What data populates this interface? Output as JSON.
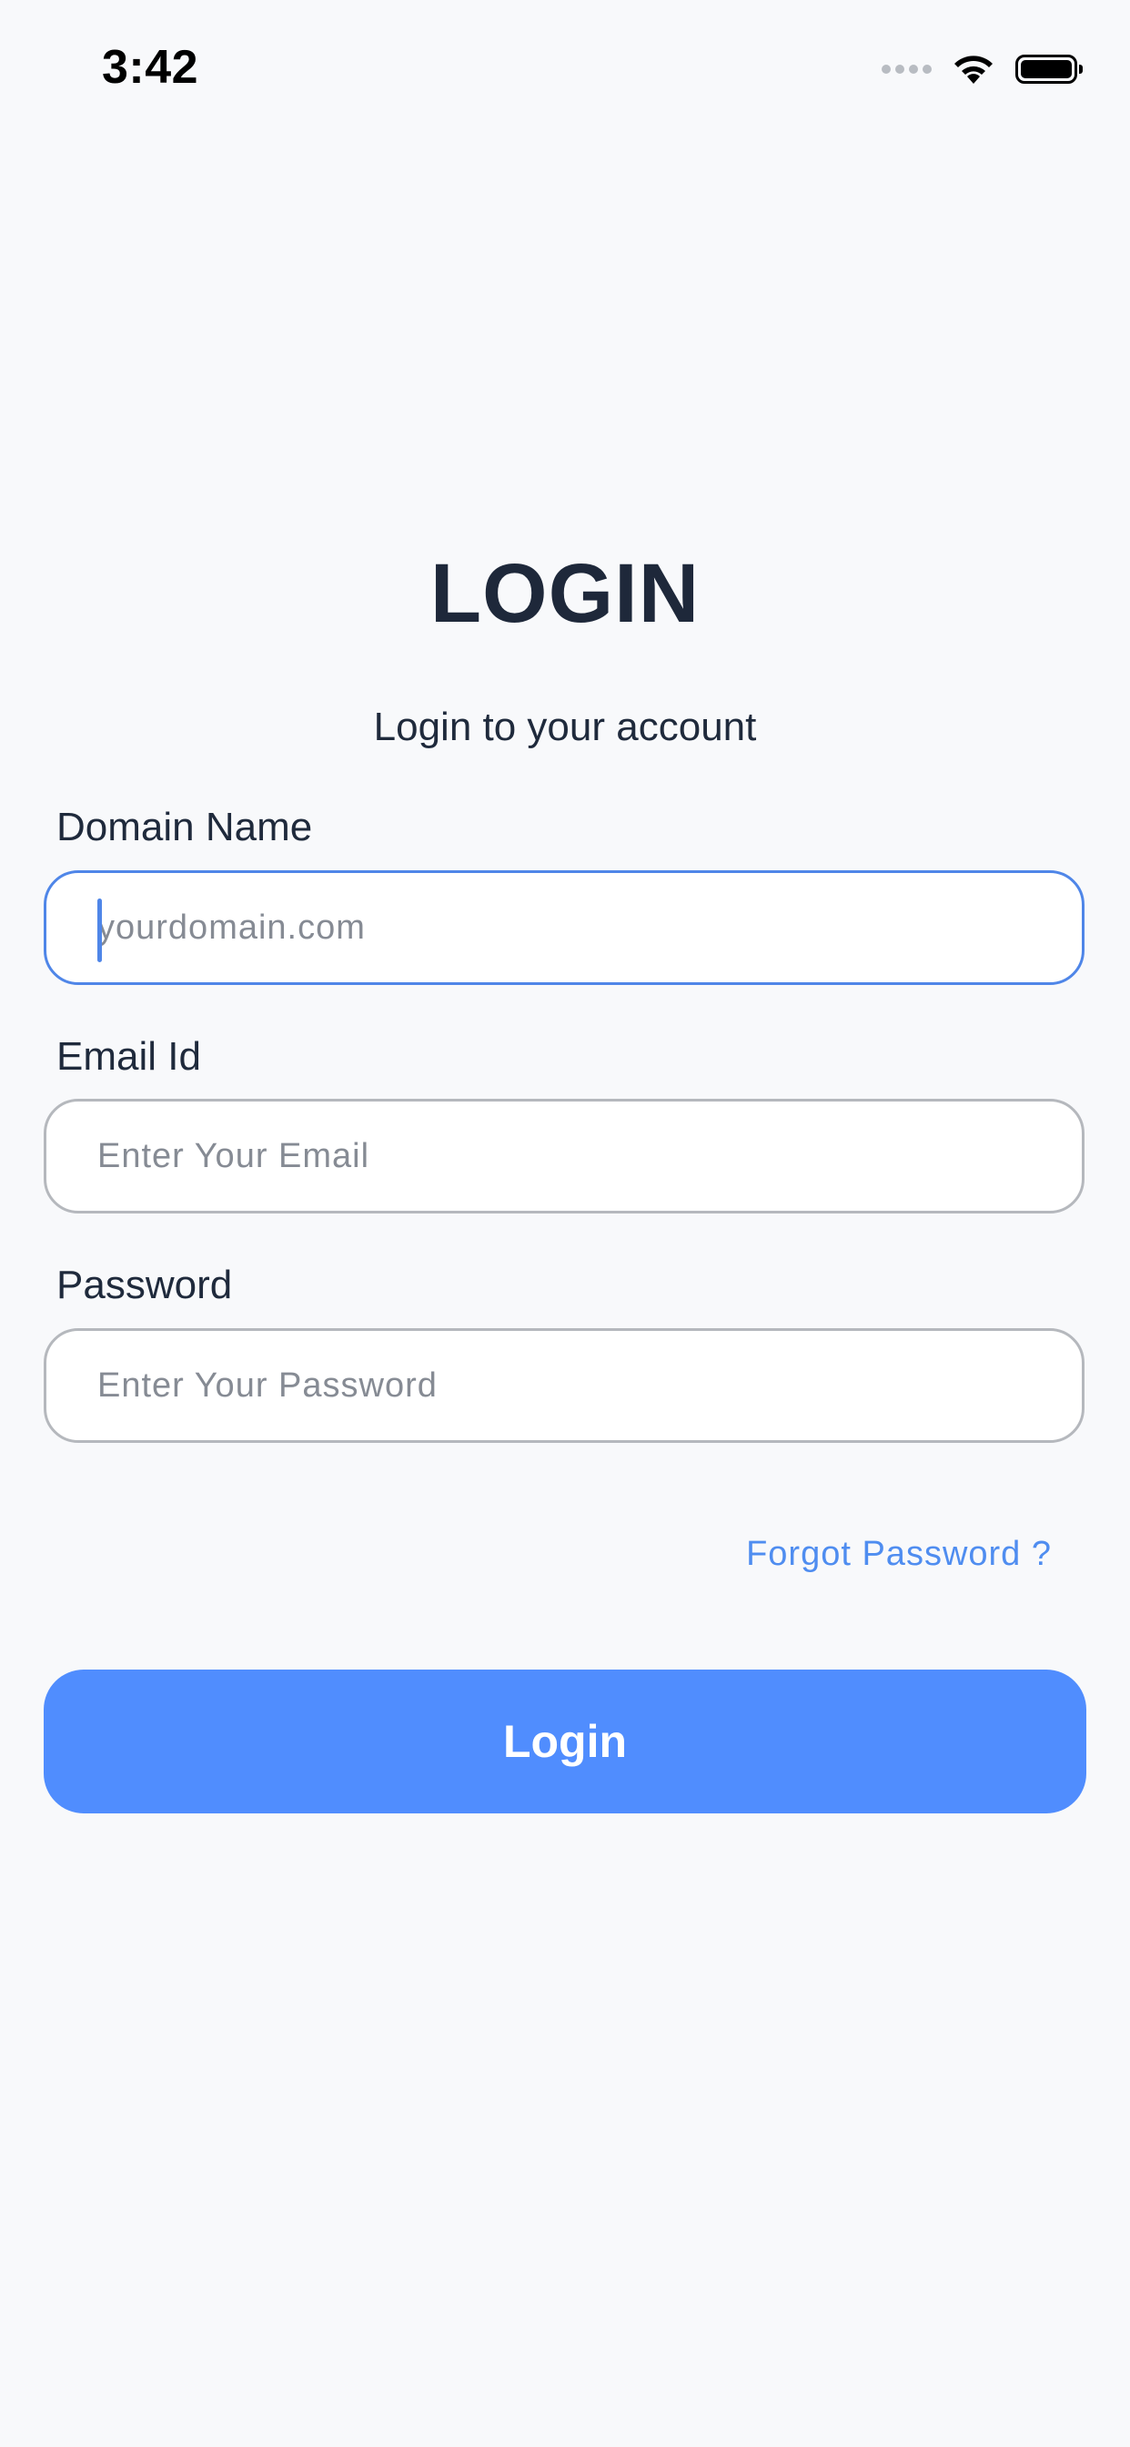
{
  "status_bar": {
    "time": "3:42"
  },
  "header": {
    "title": "LOGIN",
    "subtitle": "Login to your account"
  },
  "form": {
    "domain": {
      "label": "Domain Name",
      "placeholder": "yourdomain.com",
      "value": ""
    },
    "email": {
      "label": "Email Id",
      "placeholder": "Enter Your Email",
      "value": ""
    },
    "password": {
      "label": "Password",
      "placeholder": "Enter Your Password",
      "value": ""
    },
    "forgot_password_label": "Forgot Password ?",
    "submit_label": "Login"
  },
  "colors": {
    "accent": "#508dfe",
    "focus_border": "#4f86e8",
    "link": "#4f8df0",
    "background": "#f8f9fb",
    "text": "#1f2a3c"
  },
  "icons": [
    "signal-icon",
    "wifi-icon",
    "battery-icon"
  ]
}
